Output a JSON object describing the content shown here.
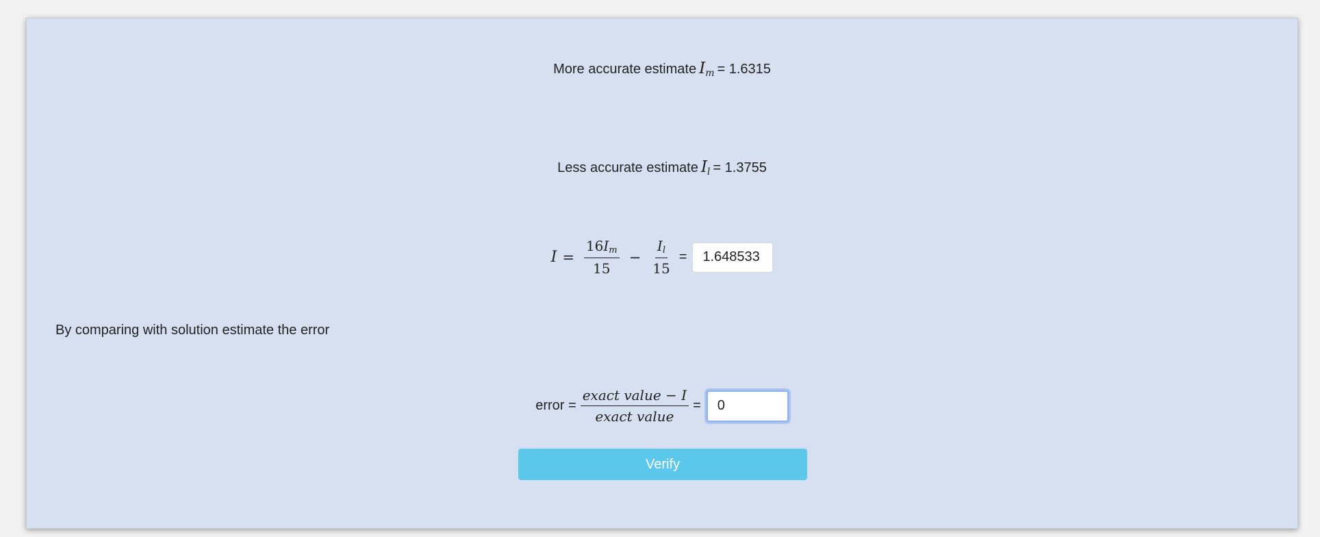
{
  "more_accurate": {
    "label": "More accurate estimate",
    "symbol": "I",
    "subscript": "m",
    "equals_value": "= 1.6315"
  },
  "less_accurate": {
    "label": "Less accurate estimate",
    "symbol": "I",
    "subscript": "l",
    "equals_value": "= 1.3755"
  },
  "richardson": {
    "lhs": "I",
    "eq": "=",
    "frac1_num": "16I",
    "frac1_num_sub": "m",
    "frac1_den": "15",
    "minus": "−",
    "frac2_num": "I",
    "frac2_num_sub": "l",
    "frac2_den": "15",
    "result_eq": "=",
    "result_value": "1.648533"
  },
  "instruction": "By comparing with solution estimate the error",
  "error_formula": {
    "label": "error =",
    "num_text": "exact value",
    "num_minus": " − ",
    "num_var": "I",
    "den_text": "exact value",
    "eq": "=",
    "input_value": "0"
  },
  "verify_button": "Verify"
}
